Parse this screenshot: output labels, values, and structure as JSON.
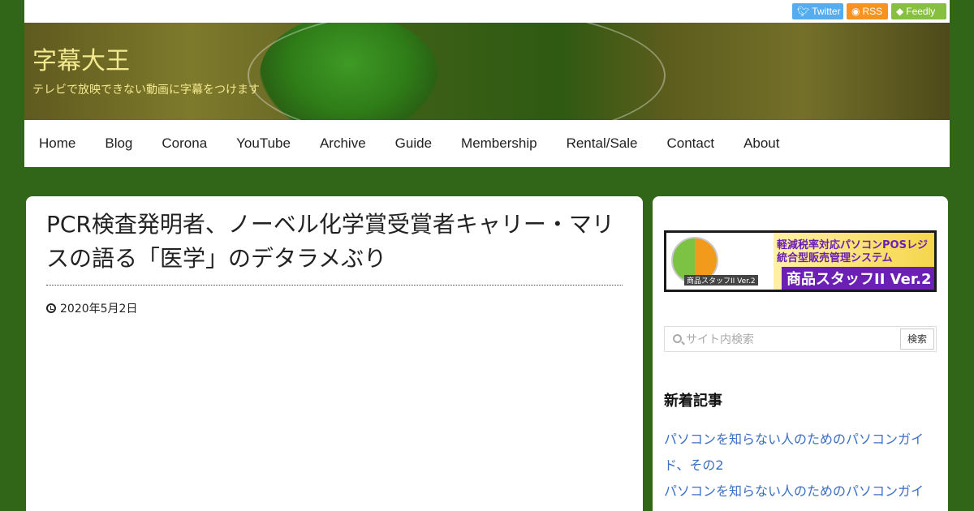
{
  "social": {
    "twitter": {
      "label": "Twitter",
      "icon": "twitter-icon",
      "color": "#55acee"
    },
    "rss": {
      "label": "RSS",
      "icon": "rss-icon",
      "color": "#f7931e"
    },
    "feedly": {
      "label": "Feedly",
      "icon": "feedly-icon",
      "color": "#87c040"
    }
  },
  "header": {
    "title": "字幕大王",
    "description": "テレビで放映できない動画に字幕をつけます"
  },
  "nav": {
    "items": [
      "Home",
      "Blog",
      "Corona",
      "YouTube",
      "Archive",
      "Guide",
      "Membership",
      "Rental/Sale",
      "Contact",
      "About"
    ]
  },
  "article": {
    "title": "PCR検査発明者、ノーベル化学賞受賞者キャリー・マリスの語る「医学」のデタラメぶり",
    "date": "2020年5月2日"
  },
  "sidebar": {
    "ad": {
      "line1": "軽減税率対応パソコンPOSレジ",
      "line2": "統合型販売管理システム",
      "line3": "商品スタッフII Ver.2",
      "logo_caption": "商品スタッフII Ver.2"
    },
    "search": {
      "placeholder": "サイト内検索",
      "button": "検索"
    },
    "recent_title": "新着記事",
    "recent_posts": [
      "パソコンを知らない人のためのパソコンガイ",
      "ド、その2",
      "パソコンを知らない人のためのパソコンガイ"
    ]
  },
  "colors": {
    "background": "#316619",
    "title_text": "#f3e98f",
    "link": "#3a6fc4"
  }
}
